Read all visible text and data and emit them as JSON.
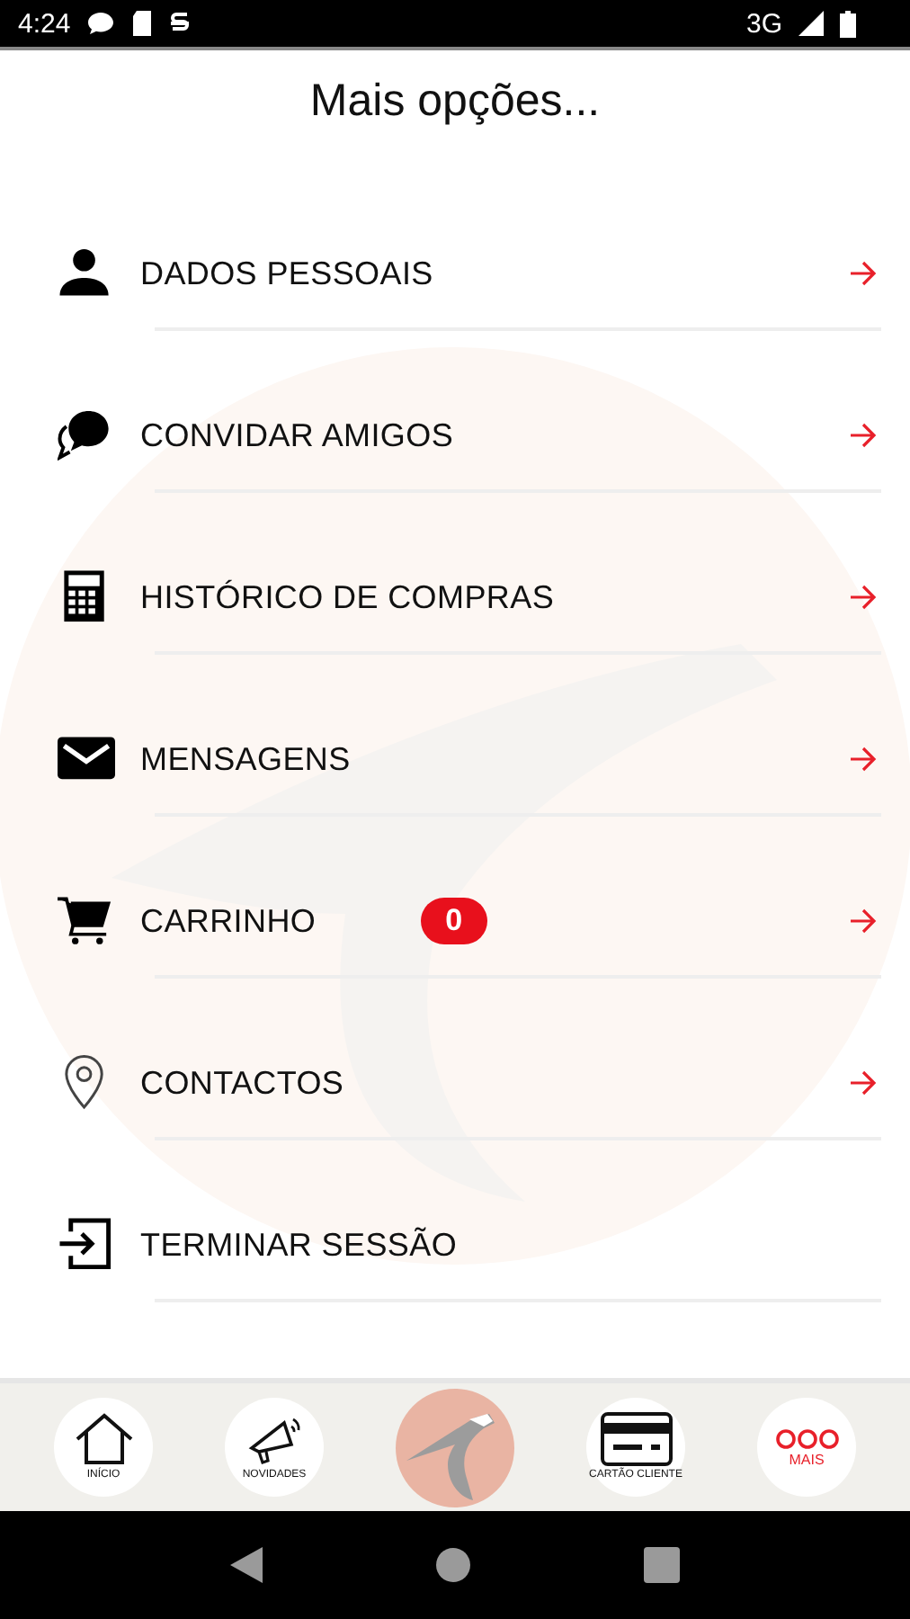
{
  "status_bar": {
    "time": "4:24",
    "network": "3G"
  },
  "title": "Mais opções...",
  "menu": [
    {
      "label": "DADOS PESSOAIS"
    },
    {
      "label": "CONVIDAR AMIGOS"
    },
    {
      "label": "HISTÓRICO DE COMPRAS"
    },
    {
      "label": "MENSAGENS"
    },
    {
      "label": "CARRINHO",
      "badge": "0"
    },
    {
      "label": "CONTACTOS"
    },
    {
      "label": "TERMINAR SESSÃO",
      "arrow": false
    }
  ],
  "bottom_nav": [
    {
      "kind": "tab",
      "label": "INÍCIO",
      "selected": false
    },
    {
      "kind": "tab",
      "label": "NOVIDADES",
      "selected": false
    },
    {
      "kind": "logo"
    },
    {
      "kind": "tab",
      "label": "CARTÃO CLIENTE",
      "selected": false
    },
    {
      "kind": "tab",
      "label": "MAIS",
      "selected": true
    }
  ]
}
